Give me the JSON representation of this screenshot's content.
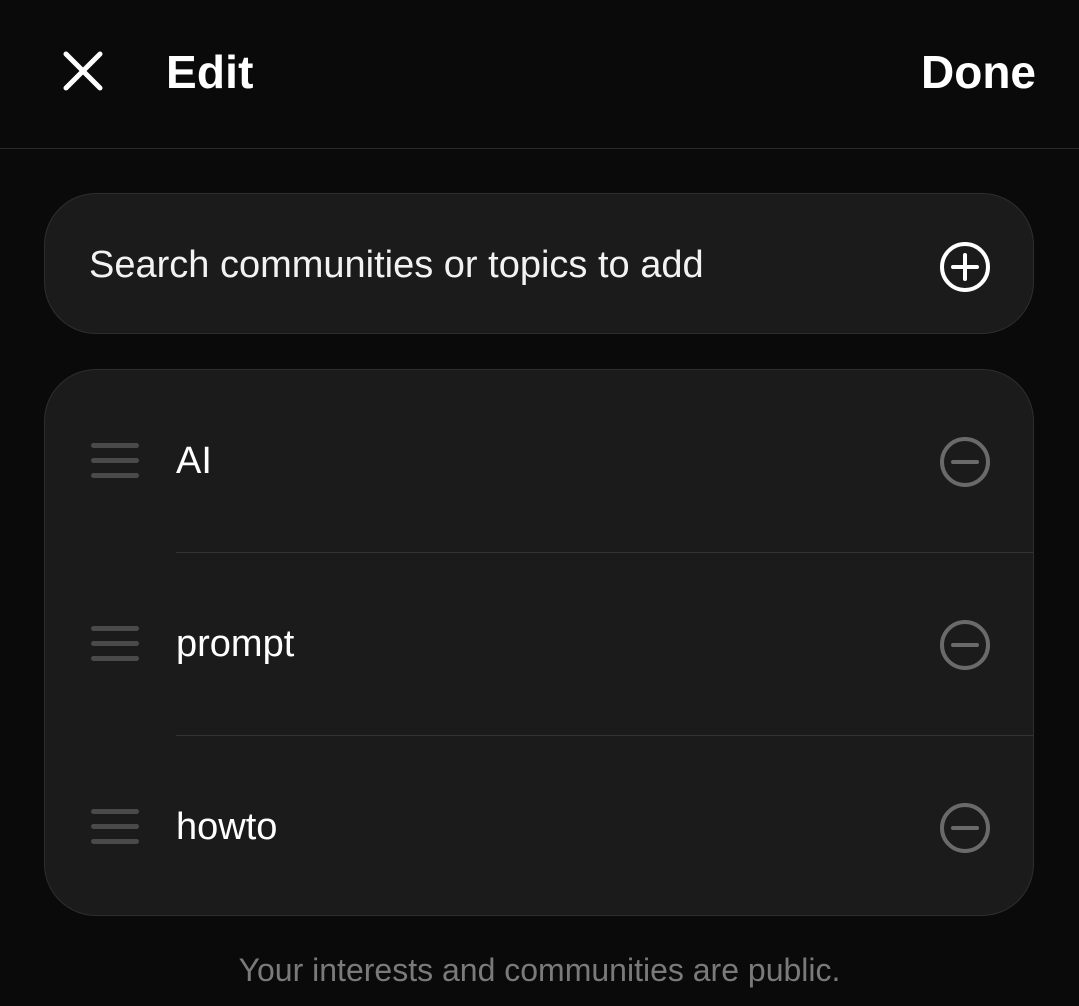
{
  "header": {
    "title": "Edit",
    "done_label": "Done",
    "close_icon": "close-icon"
  },
  "search": {
    "label": "Search communities or topics to add",
    "icon": "plus-circle-icon"
  },
  "items": [
    {
      "label": "AI"
    },
    {
      "label": "prompt"
    },
    {
      "label": "howto"
    }
  ],
  "footer": {
    "note": "Your interests and communities are public."
  },
  "colors": {
    "background": "#0a0a0a",
    "card": "#1b1b1b",
    "text": "#ffffff",
    "muted": "#7a7a7a",
    "icon_muted": "#6a6a6a"
  }
}
